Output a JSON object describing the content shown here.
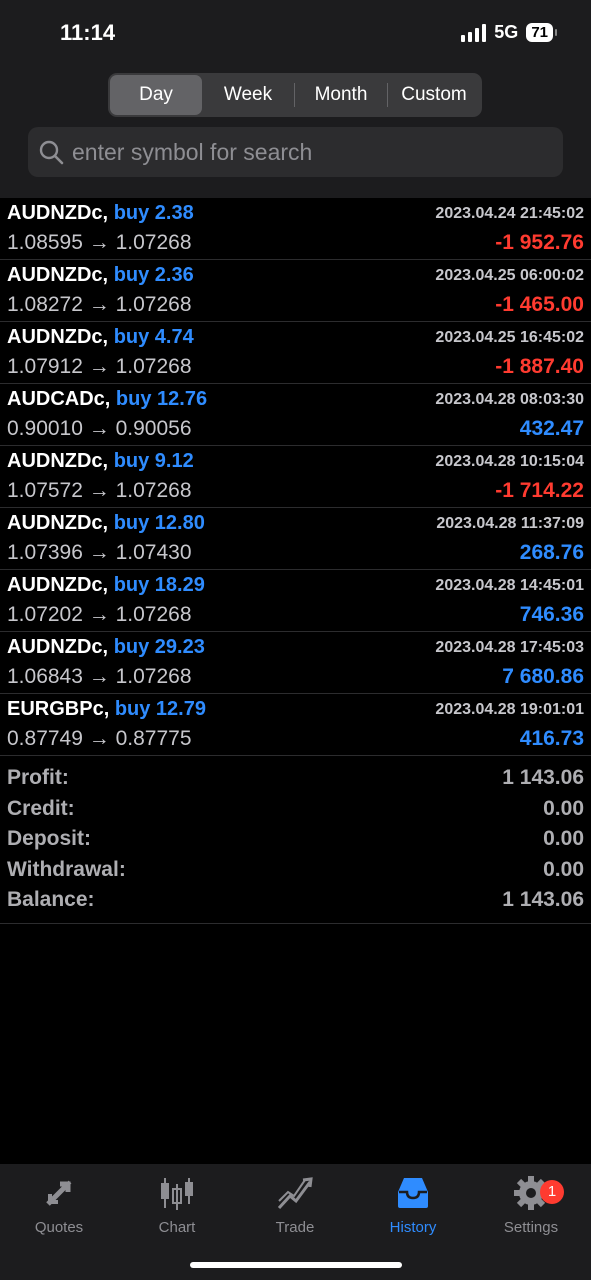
{
  "status": {
    "time": "11:14",
    "network": "5G",
    "battery": "71"
  },
  "periods": {
    "tabs": [
      "Day",
      "Week",
      "Month",
      "Custom"
    ],
    "selected": "Day"
  },
  "search": {
    "placeholder": "enter symbol for search"
  },
  "trades": [
    {
      "symbol": "AUDNZDc,",
      "side": "buy 2.38",
      "time": "2023.04.24 21:45:02",
      "open": "1.08595",
      "close": "1.07268",
      "profit": "-1 952.76",
      "type": "neg"
    },
    {
      "symbol": "AUDNZDc,",
      "side": "buy 2.36",
      "time": "2023.04.25 06:00:02",
      "open": "1.08272",
      "close": "1.07268",
      "profit": "-1 465.00",
      "type": "neg"
    },
    {
      "symbol": "AUDNZDc,",
      "side": "buy 4.74",
      "time": "2023.04.25 16:45:02",
      "open": "1.07912",
      "close": "1.07268",
      "profit": "-1 887.40",
      "type": "neg"
    },
    {
      "symbol": "AUDCADc,",
      "side": "buy 12.76",
      "time": "2023.04.28 08:03:30",
      "open": "0.90010",
      "close": "0.90056",
      "profit": "432.47",
      "type": "pos"
    },
    {
      "symbol": "AUDNZDc,",
      "side": "buy 9.12",
      "time": "2023.04.28 10:15:04",
      "open": "1.07572",
      "close": "1.07268",
      "profit": "-1 714.22",
      "type": "neg"
    },
    {
      "symbol": "AUDNZDc,",
      "side": "buy 12.80",
      "time": "2023.04.28 11:37:09",
      "open": "1.07396",
      "close": "1.07430",
      "profit": "268.76",
      "type": "pos"
    },
    {
      "symbol": "AUDNZDc,",
      "side": "buy 18.29",
      "time": "2023.04.28 14:45:01",
      "open": "1.07202",
      "close": "1.07268",
      "profit": "746.36",
      "type": "pos"
    },
    {
      "symbol": "AUDNZDc,",
      "side": "buy 29.23",
      "time": "2023.04.28 17:45:03",
      "open": "1.06843",
      "close": "1.07268",
      "profit": "7 680.86",
      "type": "pos"
    },
    {
      "symbol": "EURGBPc,",
      "side": "buy 12.79",
      "time": "2023.04.28 19:01:01",
      "open": "0.87749",
      "close": "0.87775",
      "profit": "416.73",
      "type": "pos"
    }
  ],
  "arrow": "→",
  "summary": [
    {
      "label": "Profit:",
      "value": "1 143.06"
    },
    {
      "label": "Credit:",
      "value": "0.00"
    },
    {
      "label": "Deposit:",
      "value": "0.00"
    },
    {
      "label": "Withdrawal:",
      "value": "0.00"
    },
    {
      "label": "Balance:",
      "value": "1 143.06"
    }
  ],
  "tabbar": {
    "items": [
      {
        "label": "Quotes",
        "icon": "quotes-icon"
      },
      {
        "label": "Chart",
        "icon": "chart-icon"
      },
      {
        "label": "Trade",
        "icon": "trade-icon"
      },
      {
        "label": "History",
        "icon": "history-icon"
      },
      {
        "label": "Settings",
        "icon": "gear-icon"
      }
    ],
    "active": "History",
    "settings_badge": "1"
  },
  "colors": {
    "accent": "#2f8cff",
    "loss": "#ff3b30",
    "background": "#000000"
  }
}
